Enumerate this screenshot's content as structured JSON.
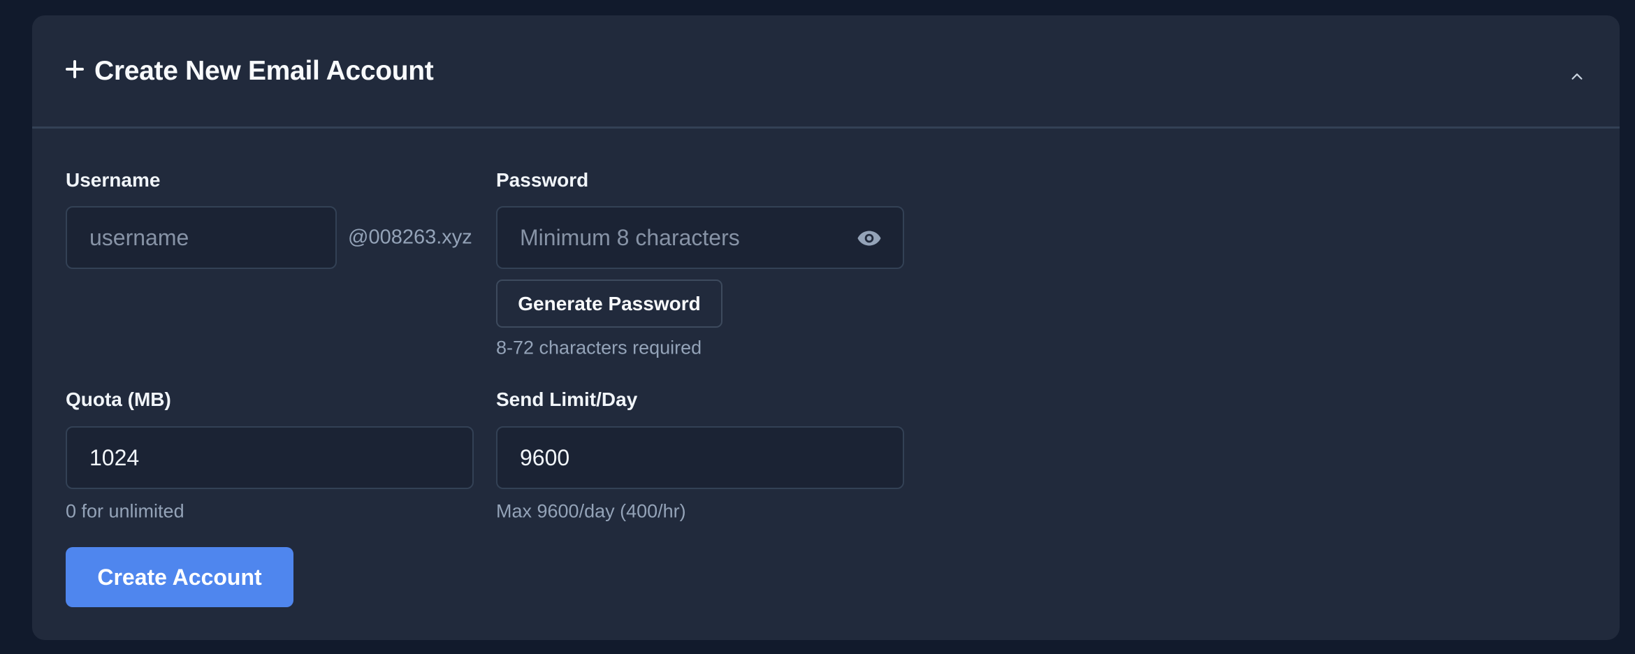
{
  "header": {
    "title": "Create New Email Account",
    "icon": "plus-icon",
    "toggle_icon": "chevron-up-icon"
  },
  "username": {
    "label": "Username",
    "value": "",
    "placeholder": "username",
    "domain_suffix": "@008263.xyz"
  },
  "password": {
    "label": "Password",
    "value": "",
    "placeholder": "Minimum 8 characters",
    "visibility_icon": "eye-icon",
    "generate_label": "Generate Password",
    "hint": "8-72 characters required"
  },
  "quota": {
    "label": "Quota (MB)",
    "value": "1024",
    "hint": "0 for unlimited"
  },
  "send_limit": {
    "label": "Send Limit/Day",
    "value": "9600",
    "hint": "Max 9600/day (400/hr)"
  },
  "submit": {
    "label": "Create Account"
  },
  "colors": {
    "page_background": "#111a2c",
    "card_background": "#212a3c",
    "input_background": "#1b2334",
    "border": "#334155",
    "accent": "#4f86ee",
    "muted_text": "#94a3b8",
    "text": "#f1f5f9"
  }
}
